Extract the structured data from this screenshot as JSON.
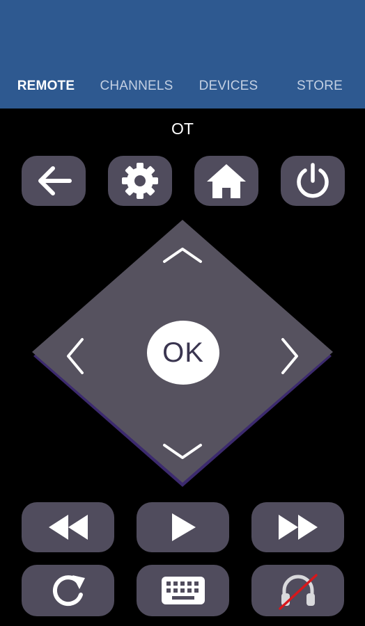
{
  "tabs": [
    {
      "label": "REMOTE",
      "active": true
    },
    {
      "label": "CHANNELS",
      "active": false
    },
    {
      "label": "DEVICES",
      "active": false
    },
    {
      "label": "STORE",
      "active": false
    }
  ],
  "device": {
    "name": "OT"
  },
  "dpad": {
    "ok_label": "OK"
  },
  "colors": {
    "header": "#2e5990",
    "button": "#504c5d",
    "dpad": "#56525f",
    "dpad_edge": "#3c2a6e",
    "background": "#000000",
    "mute_slash": "#d8171b"
  },
  "icons": {
    "back": "back-arrow-icon",
    "settings": "gear-icon",
    "home": "home-icon",
    "power": "power-icon",
    "rewind": "rewind-icon",
    "play": "play-icon",
    "fast_forward": "fast-forward-icon",
    "replay": "replay-icon",
    "keyboard": "keyboard-icon",
    "private_listening": "headphones-off-icon"
  }
}
